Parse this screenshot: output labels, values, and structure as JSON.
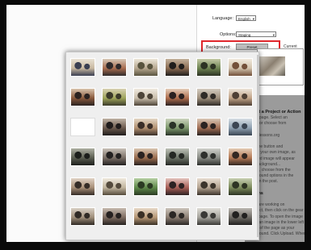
{
  "settings": {
    "language_label": "Language:",
    "language_value": "English",
    "options_label": "Options:",
    "options_value": "Staging",
    "background_label": "Background:",
    "preset_button": "Preset",
    "current_label": "Current"
  },
  "help_text": [
    "Select a Project or Action",
    "ebook page. Select an",
    "image or choose from",
    "",
    "help@lessons.org",
    "",
    "Click the button and",
    "upload your own image, as",
    "selected image will appear",
    "as a background...",
    "loaded, choose from the",
    "background options in the",
    "panel in the post.",
    "",
    "options",
    "",
    "If you are working on",
    "a project, then click on the gear",
    "of the page. To open the image",
    "select an image in the lower left",
    "corner of the page as your",
    "background. Click Upload. When you"
  ],
  "gallery": {
    "thumbnails": [
      {
        "kind": "photo",
        "colors": [
          "#c9b9a1",
          "#3a3f52",
          "#e8e1d4"
        ]
      },
      {
        "kind": "photo",
        "colors": [
          "#a96d4f",
          "#2f2a2b",
          "#d7c9b8"
        ]
      },
      {
        "kind": "photo",
        "colors": [
          "#b7a890",
          "#59543f",
          "#ece6d8"
        ]
      },
      {
        "kind": "photo",
        "colors": [
          "#8b6b52",
          "#1f1d1c",
          "#c2b19c"
        ]
      },
      {
        "kind": "photo",
        "colors": [
          "#6e8452",
          "#2d3324",
          "#c3c9a5"
        ]
      },
      {
        "kind": "photo",
        "colors": [
          "#d2c3ad",
          "#73503a",
          "#f0e9dd"
        ]
      },
      {
        "kind": "photo",
        "colors": [
          "#8a5a3d",
          "#2b2220",
          "#d9c4ad"
        ]
      },
      {
        "kind": "photo",
        "colors": [
          "#9fa55a",
          "#3b3a2a",
          "#d8d1b3"
        ]
      },
      {
        "kind": "photo",
        "colors": [
          "#cbbfac",
          "#4d4438",
          "#eee8de"
        ]
      },
      {
        "kind": "photo",
        "colors": [
          "#b06e4e",
          "#2a2121",
          "#e4cdb9"
        ]
      },
      {
        "kind": "photo",
        "colors": [
          "#9e8f7c",
          "#2f2b27",
          "#d4ccc0"
        ]
      },
      {
        "kind": "photo",
        "colors": [
          "#c2a488",
          "#4f4035",
          "#ebe3d7"
        ]
      },
      {
        "kind": "blank",
        "colors": [
          "#ffffff",
          "#ffffff",
          "#ffffff"
        ]
      },
      {
        "kind": "photo",
        "colors": [
          "#6c5a4e",
          "#201c1c",
          "#bfb2a4"
        ]
      },
      {
        "kind": "photo",
        "colors": [
          "#b49272",
          "#3a2e28",
          "#e3d6c4"
        ]
      },
      {
        "kind": "photo",
        "colors": [
          "#7f9a6e",
          "#2a3328",
          "#cbd4bd"
        ]
      },
      {
        "kind": "photo",
        "colors": [
          "#a26f55",
          "#2a2322",
          "#d9c7b6"
        ]
      },
      {
        "kind": "photo",
        "colors": [
          "#8fa1b1",
          "#3b4552",
          "#d6dee4"
        ]
      },
      {
        "kind": "photo",
        "colors": [
          "#5b5e52",
          "#1c1e1b",
          "#aeb0a2"
        ]
      },
      {
        "kind": "photo",
        "colors": [
          "#7b6f66",
          "#242121",
          "#c8c0b7"
        ]
      },
      {
        "kind": "photo",
        "colors": [
          "#9c6d4f",
          "#2a2221",
          "#d8c5b1"
        ]
      },
      {
        "kind": "photo",
        "colors": [
          "#6d7468",
          "#252824",
          "#bdc1b7"
        ]
      },
      {
        "kind": "photo",
        "colors": [
          "#8a8c86",
          "#2e302d",
          "#cfd0cb"
        ]
      },
      {
        "kind": "photo",
        "colors": [
          "#b57a56",
          "#332822",
          "#e3cbb5"
        ]
      },
      {
        "kind": "photo",
        "colors": [
          "#a88f78",
          "#352c27",
          "#e0d3c5"
        ]
      },
      {
        "kind": "photo",
        "colors": [
          "#c1b59e",
          "#554b3d",
          "#efe9dd"
        ]
      },
      {
        "kind": "photo",
        "colors": [
          "#5f8a4a",
          "#2b3a23",
          "#b6cfa3"
        ]
      },
      {
        "kind": "photo",
        "colors": [
          "#a95f57",
          "#2d2223",
          "#e3c3bd"
        ]
      },
      {
        "kind": "photo",
        "colors": [
          "#b4a390",
          "#3c342c",
          "#e7ddd1"
        ]
      },
      {
        "kind": "photo",
        "colors": [
          "#7c8b5c",
          "#2e3424",
          "#c7cfb1"
        ]
      },
      {
        "kind": "photo",
        "colors": [
          "#9f8e7a",
          "#302a25",
          "#d9d0c4"
        ]
      },
      {
        "kind": "photo",
        "colors": [
          "#7d6b5f",
          "#272221",
          "#c5b9ae"
        ]
      },
      {
        "kind": "photo",
        "colors": [
          "#b89876",
          "#3a3026",
          "#e6d8c6"
        ]
      },
      {
        "kind": "photo",
        "colors": [
          "#8b7d72",
          "#2b2725",
          "#cbc3ba"
        ]
      },
      {
        "kind": "photo",
        "colors": [
          "#a5a39c",
          "#3a3936",
          "#dedcd6"
        ]
      },
      {
        "kind": "photo",
        "colors": [
          "#6e6a64",
          "#222120",
          "#bcb8b2"
        ]
      }
    ]
  }
}
